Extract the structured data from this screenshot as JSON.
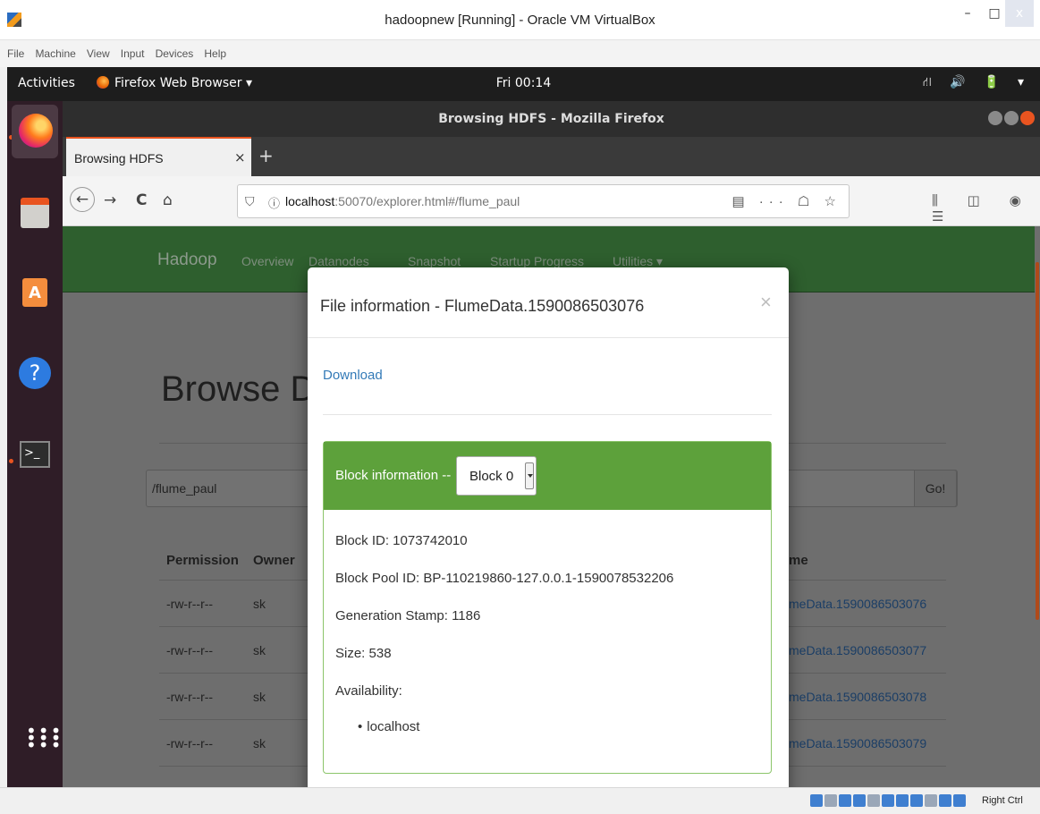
{
  "vbox": {
    "title": "hadoopnew [Running] - Oracle VM VirtualBox",
    "menu": [
      "File",
      "Machine",
      "View",
      "Input",
      "Devices",
      "Help"
    ],
    "controls": {
      "minimize": "–",
      "maximize": "□",
      "close": "x"
    },
    "status": {
      "host_key": "Right Ctrl"
    }
  },
  "gnome": {
    "activities": "Activities",
    "app_menu": "Firefox Web Browser ▾",
    "clock": "Fri 00:14",
    "tray": "⛙ 🔊 🔋 ▾"
  },
  "dock": {
    "items": [
      "firefox",
      "files",
      "software",
      "help",
      "terminal",
      "show-applications"
    ]
  },
  "firefox": {
    "window_title": "Browsing HDFS - Mozilla Firefox",
    "tab": {
      "label": "Browsing HDFS",
      "close": "×"
    },
    "new_tab": "+",
    "url": {
      "host": "localhost",
      "rest": ":50070/explorer.html#/flume_paul"
    },
    "nav": {
      "back": "←",
      "forward": "→",
      "reload": "C",
      "home": "⌂"
    },
    "url_actions": "▤ ··· ☖ ☆",
    "toolbar_right": "⫼ ◫ ◉ ☰"
  },
  "hadoop": {
    "brand": "Hadoop",
    "nav": [
      "Overview",
      "Datanodes",
      "Snapshot",
      "Startup Progress",
      "Utilities ▾"
    ],
    "page_title": "Browse Dir",
    "path_value": "/flume_paul",
    "go_button": "Go!",
    "table": {
      "headers": [
        "Permission",
        "Owner",
        "me"
      ],
      "rows": [
        {
          "permission": "-rw-r--r--",
          "owner": "sk",
          "name": "meData.1590086503076"
        },
        {
          "permission": "-rw-r--r--",
          "owner": "sk",
          "name": "meData.1590086503077"
        },
        {
          "permission": "-rw-r--r--",
          "owner": "sk",
          "name": "meData.1590086503078"
        },
        {
          "permission": "-rw-r--r--",
          "owner": "sk",
          "name": "meData.1590086503079"
        }
      ]
    }
  },
  "modal": {
    "title": "File information - FlumeData.1590086503076",
    "close": "×",
    "download": "Download",
    "block_label": "Block information --",
    "block_selected": "Block 0",
    "block_id": "Block ID: 1073742010",
    "block_pool_id": "Block Pool ID: BP-110219860-127.0.0.1-1590078532206",
    "generation_stamp": "Generation Stamp: 1186",
    "size": "Size: 538",
    "availability_label": "Availability:",
    "availability": [
      "localhost"
    ]
  }
}
